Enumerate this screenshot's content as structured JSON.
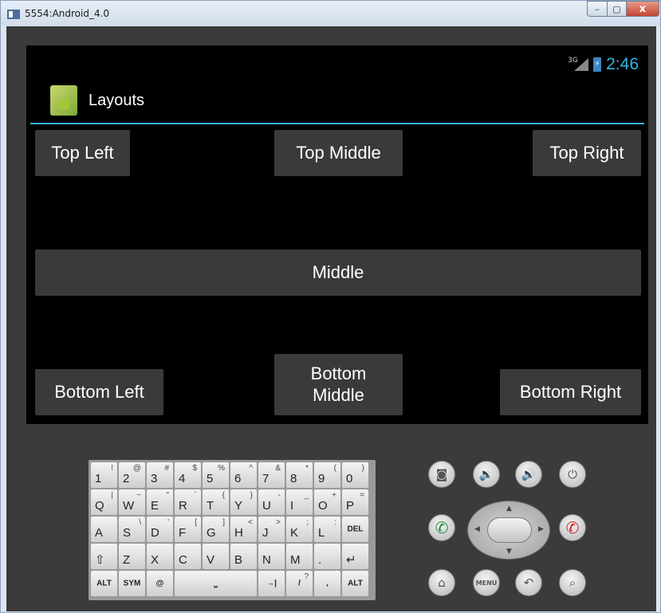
{
  "window": {
    "title": "5554:Android_4.0",
    "minimize": "–",
    "maximize": "▢",
    "close": "x"
  },
  "status": {
    "network": "3G",
    "time": "2:46",
    "battery": "⚡"
  },
  "app": {
    "title": "Layouts"
  },
  "buttons": {
    "top_left": "Top Left",
    "top_middle": "Top Middle",
    "top_right": "Top Right",
    "middle": "Middle",
    "bottom_left": "Bottom Left",
    "bottom_middle": "Bottom\nMiddle",
    "bottom_right": "Bottom Right"
  },
  "keyboard": {
    "rows": [
      [
        {
          "m": "1",
          "s": "!"
        },
        {
          "m": "2",
          "s": "@"
        },
        {
          "m": "3",
          "s": "#"
        },
        {
          "m": "4",
          "s": "$"
        },
        {
          "m": "5",
          "s": "%"
        },
        {
          "m": "6",
          "s": "^"
        },
        {
          "m": "7",
          "s": "&"
        },
        {
          "m": "8",
          "s": "*"
        },
        {
          "m": "9",
          "s": "("
        },
        {
          "m": "0",
          "s": ")"
        }
      ],
      [
        {
          "m": "Q",
          "s": "|"
        },
        {
          "m": "W",
          "s": "~"
        },
        {
          "m": "E",
          "s": "\""
        },
        {
          "m": "R",
          "s": "`"
        },
        {
          "m": "T",
          "s": "{"
        },
        {
          "m": "Y",
          "s": "}"
        },
        {
          "m": "U",
          "s": "-"
        },
        {
          "m": "I",
          "s": "_"
        },
        {
          "m": "O",
          "s": "+"
        },
        {
          "m": "P",
          "s": "="
        }
      ],
      [
        {
          "m": "A",
          "s": ""
        },
        {
          "m": "S",
          "s": "\\"
        },
        {
          "m": "D",
          "s": "'"
        },
        {
          "m": "F",
          "s": "["
        },
        {
          "m": "G",
          "s": "]"
        },
        {
          "m": "H",
          "s": "<"
        },
        {
          "m": "J",
          "s": ">"
        },
        {
          "m": "K",
          "s": ";"
        },
        {
          "m": "L",
          "s": ":"
        },
        {
          "m": "",
          "s": "",
          "c": "DEL"
        }
      ],
      [
        {
          "m": "⇧",
          "s": ""
        },
        {
          "m": "Z",
          "s": ""
        },
        {
          "m": "X",
          "s": ""
        },
        {
          "m": "C",
          "s": ""
        },
        {
          "m": "V",
          "s": ""
        },
        {
          "m": "B",
          "s": ""
        },
        {
          "m": "N",
          "s": ""
        },
        {
          "m": "M",
          "s": ""
        },
        {
          "m": ".",
          "s": ""
        },
        {
          "m": "↵",
          "s": ""
        }
      ]
    ],
    "bottom": {
      "alt_left": "ALT",
      "sym": "SYM",
      "at": "@",
      "space": "⎵",
      "tab": "→|",
      "slash": "/",
      "question": "?",
      "comma": ",",
      "alt_right": "ALT"
    }
  },
  "controls": {
    "camera": "◙",
    "vol_down": "🔉",
    "vol_up": "🔊",
    "power": "⏻",
    "call": "✆",
    "end": "✆",
    "home": "⌂",
    "menu": "MENU",
    "back": "↶",
    "search": "⌕"
  }
}
